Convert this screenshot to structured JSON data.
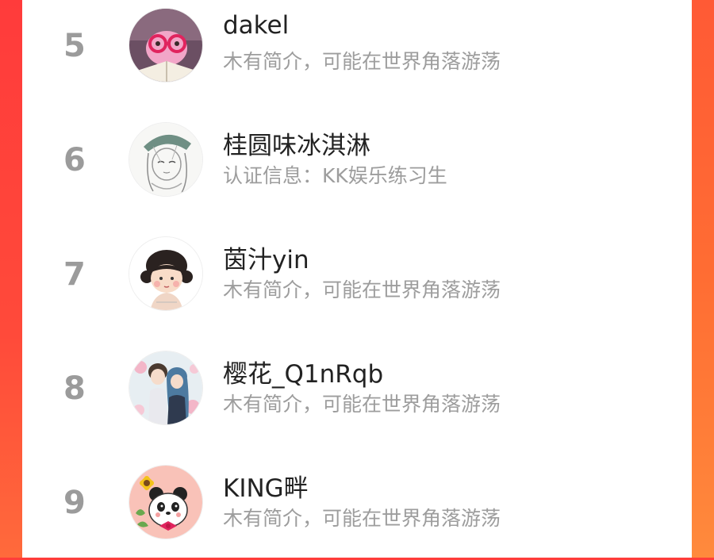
{
  "leaderboard": {
    "entries": [
      {
        "rank": "5",
        "name": "dakel",
        "bio": "木有简介，可能在世界角落游荡",
        "avatar_icon": "glasses-character-avatar"
      },
      {
        "rank": "6",
        "name": "桂圆味冰淇淋",
        "bio": "认证信息：KK娱乐练习生",
        "avatar_icon": "sketch-girl-avatar"
      },
      {
        "rank": "7",
        "name": "茵汁yin",
        "bio": "木有简介，可能在世界角落游荡",
        "avatar_icon": "cartoon-child-avatar"
      },
      {
        "rank": "8",
        "name": "樱花_Q1nRqb",
        "bio": "木有简介，可能在世界角落游荡",
        "avatar_icon": "anime-couple-avatar"
      },
      {
        "rank": "9",
        "name": "KING畔",
        "bio": "木有简介，可能在世界角落游荡",
        "avatar_icon": "panda-sunflower-avatar"
      }
    ]
  },
  "colors": {
    "background_gradient_top": "#ff3d3a",
    "background_gradient_bottom": "#ff7a3a",
    "rank_color": "#9b9b9b",
    "name_color": "#222222",
    "bio_color": "#9d9d9d"
  }
}
